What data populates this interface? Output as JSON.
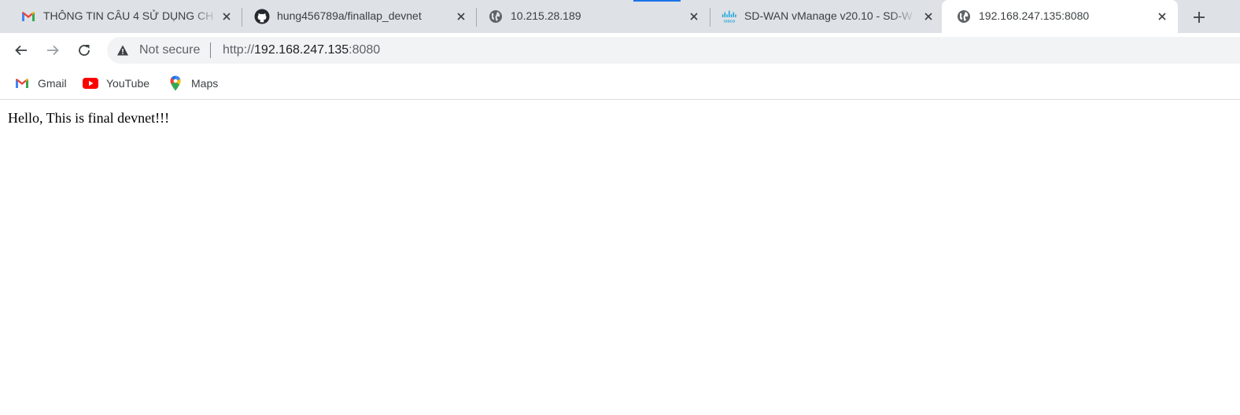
{
  "tabs": [
    {
      "title": "THÔNG TIN CÂU 4 SỬ DỤNG CH",
      "icon": "gmail-icon"
    },
    {
      "title": "hung456789a/finallap_devnet",
      "icon": "github-icon"
    },
    {
      "title": "10.215.28.189",
      "icon": "globe-icon"
    },
    {
      "title": "SD-WAN vManage v20.10 - SD-W",
      "icon": "cisco-icon"
    },
    {
      "title": "192.168.247.135:8080",
      "icon": "globe-icon",
      "active": true
    }
  ],
  "toolbar": {
    "security_label": "Not secure",
    "url_scheme": "http://",
    "url_host": "192.168.247.135",
    "url_port": ":8080"
  },
  "bookmarks": [
    {
      "label": "Gmail",
      "icon": "gmail-icon"
    },
    {
      "label": "YouTube",
      "icon": "youtube-icon"
    },
    {
      "label": "Maps",
      "icon": "maps-icon"
    }
  ],
  "page": {
    "text": "Hello, This is final devnet!!!"
  },
  "colors": {
    "tabstrip": "#dee1e6",
    "omnibox": "#f1f3f4",
    "active_tab_indicator": "#1a73e8"
  }
}
